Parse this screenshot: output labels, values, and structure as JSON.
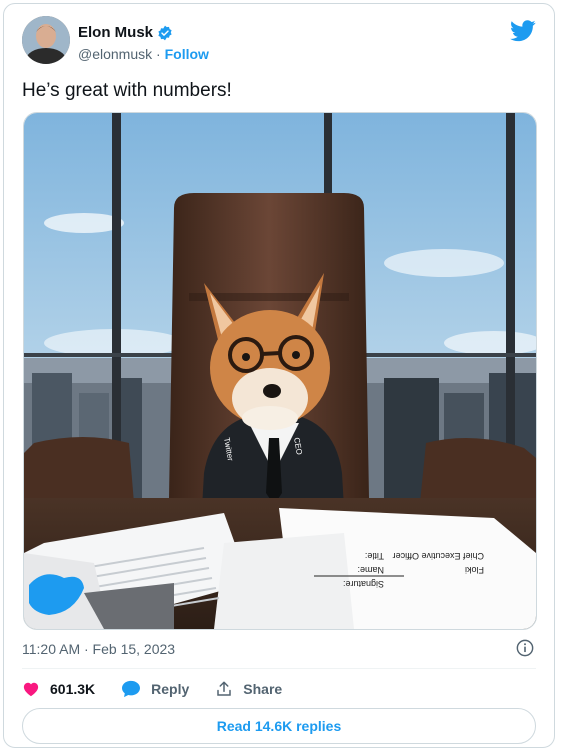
{
  "tweet": {
    "author_name": "Elon Musk",
    "handle": "@elonmusk",
    "separator": " · ",
    "follow_label": "Follow",
    "text": "He’s great with numbers!",
    "timestamp": "11:20 AM · Feb 15, 2023",
    "likes": "601.3K",
    "reply_label": "Reply",
    "share_label": "Share",
    "read_replies_label": "Read 14.6K replies"
  },
  "image": {
    "tie_left": "Twitter",
    "tie_right": "CEO",
    "doc_signature": "Signature:",
    "doc_name_label": "Name:",
    "doc_title_label": "Title:",
    "doc_name_value": "Floki",
    "doc_title_value": "Chief Executive Officer"
  },
  "colors": {
    "accent": "#1d9bf0",
    "like": "#f91880",
    "muted": "#536471"
  },
  "icons": [
    "verified-badge-icon",
    "twitter-bird-icon",
    "info-icon",
    "heart-icon",
    "reply-bubble-icon",
    "share-icon"
  ]
}
